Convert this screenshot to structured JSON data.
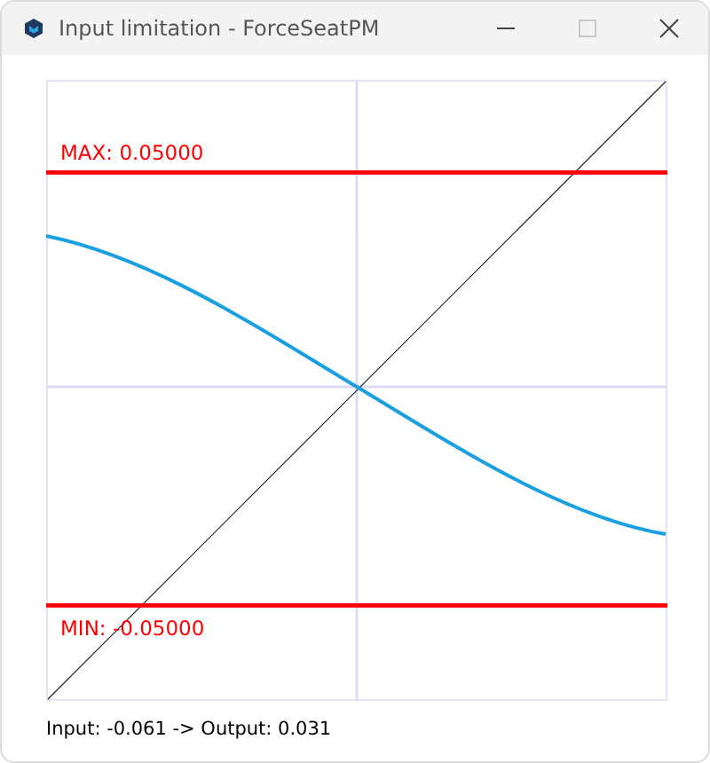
{
  "window": {
    "title": "Input limitation - ForceSeatPM"
  },
  "limits": [
    {
      "kind": "max",
      "label": "MAX: 0.05000"
    },
    {
      "kind": "min",
      "label": "MIN: -0.05000"
    }
  ],
  "status": "Input: -0.061 -> Output: 0.031"
}
